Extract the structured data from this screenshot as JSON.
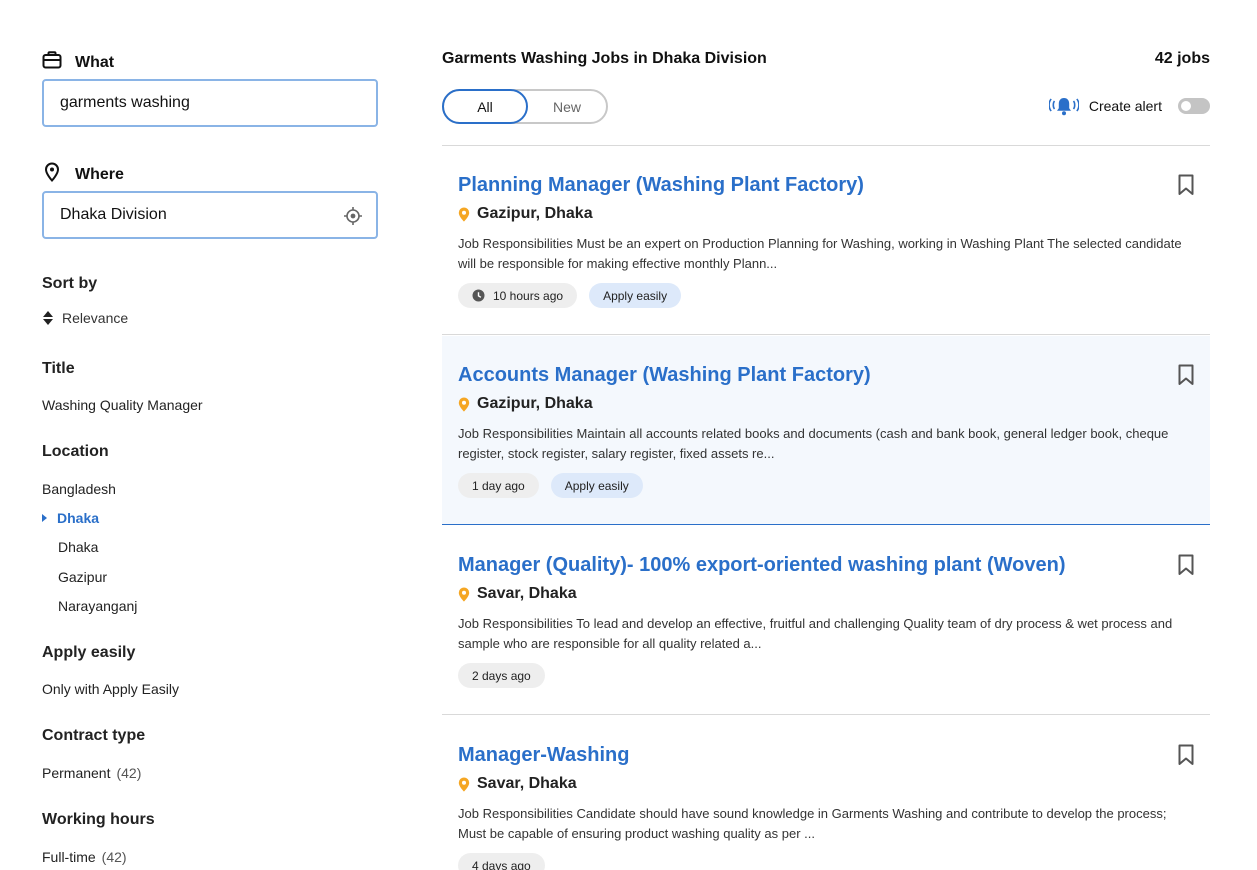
{
  "search": {
    "what_label": "What",
    "what_value": "garments washing",
    "where_label": "Where",
    "where_value": "Dhaka Division"
  },
  "filters": {
    "sort_title": "Sort by",
    "sort_value": "Relevance",
    "title_section": "Title",
    "title_item": "Washing Quality Manager",
    "location_section": "Location",
    "location_items": {
      "country": "Bangladesh",
      "selected": "Dhaka",
      "sub": [
        "Dhaka",
        "Gazipur",
        "Narayanganj"
      ]
    },
    "apply_section": "Apply easily",
    "apply_item": "Only with Apply Easily",
    "contract_section": "Contract type",
    "contract_item": "Permanent",
    "contract_count": "(42)",
    "hours_section": "Working hours",
    "hours_item": "Full-time",
    "hours_count": "(42)"
  },
  "header": {
    "title": "Garments Washing Jobs in Dhaka Division",
    "count": "42 jobs",
    "tab_all": "All",
    "tab_new": "New",
    "alert_label": "Create alert"
  },
  "jobs": [
    {
      "title": "Planning Manager (Washing Plant Factory)",
      "location": "Gazipur, Dhaka",
      "desc": "Job Responsibilities Must be an expert on Production Planning for Washing, working in Washing Plant The selected candidate will be responsible for making effective monthly Plann...",
      "posted": "10 hours ago",
      "apply": "Apply easily"
    },
    {
      "title": "Accounts Manager (Washing Plant Factory)",
      "location": "Gazipur, Dhaka",
      "desc": "Job Responsibilities Maintain all accounts related books and documents (cash and bank book, general ledger book, cheque register, stock register, salary register, fixed assets re...",
      "posted": "1 day ago",
      "apply": "Apply easily"
    },
    {
      "title": "Manager (Quality)- 100% export-oriented washing plant (Woven)",
      "location": "Savar, Dhaka",
      "desc": "Job Responsibilities To lead and develop an effective, fruitful and challenging Quality team of dry process & wet process and sample who are responsible for all quality related a...",
      "posted": "2 days ago"
    },
    {
      "title": "Manager-Washing",
      "location": "Savar, Dhaka",
      "desc": "Job Responsibilities Candidate should have sound knowledge in Garments Washing and contribute to develop the process; Must be capable of ensuring product washing quality as per ...",
      "posted": "4 days ago"
    }
  ],
  "colors": {
    "accent": "#2a6fc9",
    "pin": "#f5a623",
    "input_border": "#8ab4e6"
  },
  "icons": [
    "briefcase-icon",
    "map-pin-icon",
    "crosshair-icon",
    "sort-icon",
    "bell-icon",
    "bookmark-icon",
    "clock-icon"
  ]
}
